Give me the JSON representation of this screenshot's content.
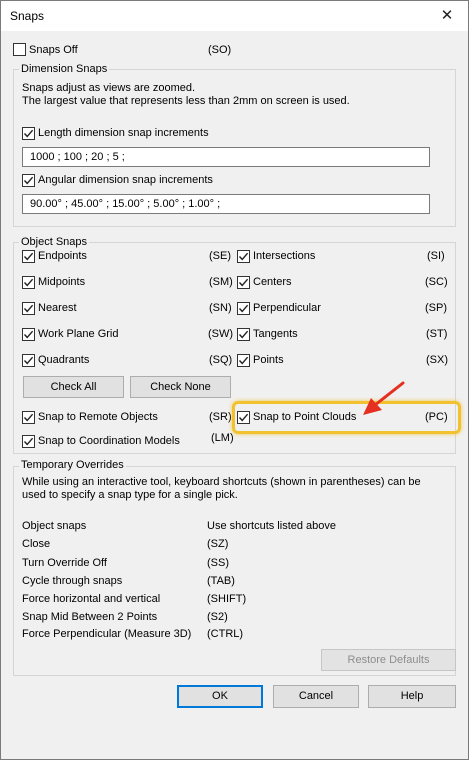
{
  "window": {
    "title": "Snaps",
    "close_glyph": "✕"
  },
  "snaps_off": {
    "label": "Snaps Off",
    "shortcut": "(SO)",
    "checked": false
  },
  "dimension_snaps": {
    "legend": "Dimension Snaps",
    "desc_line1": "Snaps adjust as views are zoomed.",
    "desc_line2": "The largest value that represents less than 2mm on screen is used.",
    "length": {
      "label": "Length dimension snap increments",
      "checked": true,
      "value": "1000 ; 100 ; 20 ; 5 ;"
    },
    "angular": {
      "label": "Angular dimension snap increments",
      "checked": true,
      "value": "90.00° ; 45.00° ; 15.00° ; 5.00° ; 1.00° ;"
    }
  },
  "object_snaps": {
    "legend": "Object Snaps",
    "left": [
      {
        "label": "Endpoints",
        "shortcut": "(SE)",
        "checked": true
      },
      {
        "label": "Midpoints",
        "shortcut": "(SM)",
        "checked": true
      },
      {
        "label": "Nearest",
        "shortcut": "(SN)",
        "checked": true
      },
      {
        "label": "Work Plane Grid",
        "shortcut": "(SW)",
        "checked": true
      },
      {
        "label": "Quadrants",
        "shortcut": "(SQ)",
        "checked": true
      }
    ],
    "right": [
      {
        "label": "Intersections",
        "shortcut": "(SI)",
        "checked": true
      },
      {
        "label": "Centers",
        "shortcut": "(SC)",
        "checked": true
      },
      {
        "label": "Perpendicular",
        "shortcut": "(SP)",
        "checked": true
      },
      {
        "label": "Tangents",
        "shortcut": "(ST)",
        "checked": true
      },
      {
        "label": "Points",
        "shortcut": "(SX)",
        "checked": true
      }
    ],
    "check_all": "Check All",
    "check_none": "Check None",
    "remote": {
      "label": "Snap to Remote Objects",
      "shortcut": "(SR)",
      "checked": true
    },
    "point_clouds": {
      "label": "Snap to Point Clouds",
      "shortcut": "(PC)",
      "checked": true
    },
    "coordination": {
      "label": "Snap to Coordination Models",
      "shortcut": "(LM)",
      "checked": true
    }
  },
  "temporary_overrides": {
    "legend": "Temporary Overrides",
    "desc_line1": "While using an interactive tool, keyboard shortcuts (shown in parentheses) can be",
    "desc_line2": "used to specify a snap type for a single pick.",
    "rows": [
      {
        "name": "Object snaps",
        "value": "Use shortcuts listed above"
      },
      {
        "name": "Close",
        "value": "(SZ)"
      },
      {
        "name": "Turn Override Off",
        "value": "(SS)"
      },
      {
        "name": "Cycle through snaps",
        "value": "(TAB)"
      },
      {
        "name": "Force horizontal and vertical",
        "value": "(SHIFT)"
      },
      {
        "name": "Snap Mid Between 2 Points",
        "value": "(S2)"
      },
      {
        "name": "Force Perpendicular (Measure 3D)",
        "value": "(CTRL)"
      }
    ],
    "restore_defaults": "Restore Defaults"
  },
  "buttons": {
    "ok": "OK",
    "cancel": "Cancel",
    "help": "Help"
  },
  "colors": {
    "highlight": "#f2c12e",
    "arrow": "#e53021",
    "default_border": "#0078d7"
  }
}
